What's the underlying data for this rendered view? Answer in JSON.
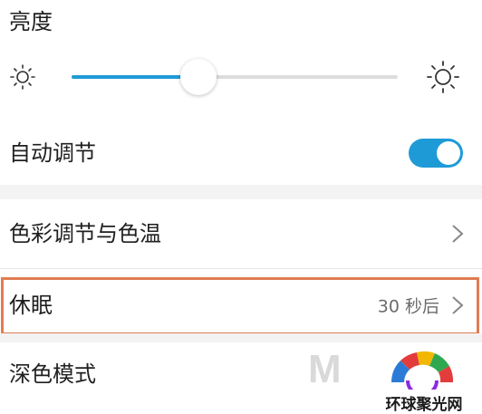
{
  "brightness": {
    "section_label": "亮度",
    "level": 0.39
  },
  "auto_adjust": {
    "label": "自动调节",
    "enabled": true
  },
  "color_temp": {
    "label": "色彩调节与色温"
  },
  "sleep": {
    "label": "休眠",
    "value": "30 秒后"
  },
  "dark_mode": {
    "label": "深色模式"
  },
  "watermark": {
    "text": "环球聚光网"
  },
  "colors": {
    "accent": "#1e9bd7",
    "highlight": "#e07d52"
  },
  "icons": {
    "brightness_low": "sun-small-icon",
    "brightness_high": "sun-large-icon",
    "chevron": "chevron-right-icon"
  }
}
